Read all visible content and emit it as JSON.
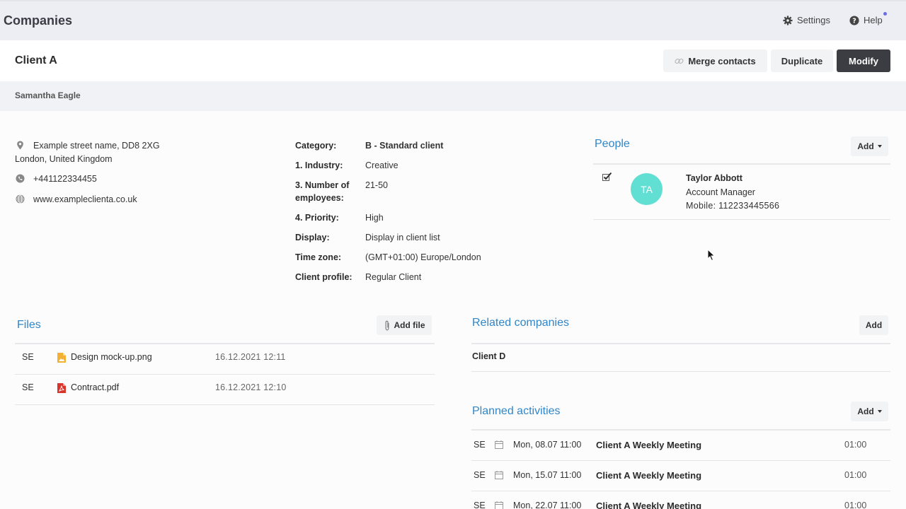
{
  "app": {
    "page_title": "Companies",
    "settings_label": "Settings",
    "help_label": "Help"
  },
  "client": {
    "name": "Client A",
    "owner": "Samantha Eagle",
    "buttons": {
      "merge": "Merge contacts",
      "duplicate": "Duplicate",
      "modify": "Modify"
    },
    "address_line1": "Example street name, DD8 2XG",
    "address_line2": "London, United Kingdom",
    "phone": "+441122334455",
    "website": "www.exampleclienta.co.uk"
  },
  "details": [
    {
      "label": "Category:",
      "value": "B - Standard client"
    },
    {
      "label": "1. Industry:",
      "value": "Creative"
    },
    {
      "label": "3. Number of employees:",
      "value": "21-50"
    },
    {
      "label": "4. Priority:",
      "value": "High"
    },
    {
      "label": "Display:",
      "value": "Display in client list"
    },
    {
      "label": "Time zone:",
      "value": "(GMT+01:00) Europe/London"
    },
    {
      "label": "Client profile:",
      "value": "Regular Client"
    }
  ],
  "people": {
    "title": "People",
    "add_label": "Add",
    "items": [
      {
        "initials": "TA",
        "name": "Taylor Abbott",
        "role": "Account Manager",
        "mobile": "Mobile: 112233445566",
        "avatar_color": "#62dfd3"
      }
    ]
  },
  "files": {
    "title": "Files",
    "add_label": "Add file",
    "items": [
      {
        "owner": "SE",
        "name": "Design mock-up.png",
        "date": "16.12.2021 12:11",
        "icon": "image-file-icon"
      },
      {
        "owner": "SE",
        "name": "Contract.pdf",
        "date": "16.12.2021 12:10",
        "icon": "pdf-file-icon"
      }
    ]
  },
  "related": {
    "title": "Related companies",
    "add_label": "Add",
    "items": [
      "Client D"
    ]
  },
  "activities": {
    "title": "Planned activities",
    "add_label": "Add",
    "items": [
      {
        "owner": "SE",
        "when": "Mon, 08.07 11:00",
        "name": "Client A Weekly Meeting",
        "duration": "01:00"
      },
      {
        "owner": "SE",
        "when": "Mon, 15.07 11:00",
        "name": "Client A Weekly Meeting",
        "duration": "01:00"
      },
      {
        "owner": "SE",
        "when": "Mon, 22.07 11:00",
        "name": "Client A Weekly Meeting",
        "duration": "01:00"
      }
    ]
  },
  "colors": {
    "accent": "#2f86c9",
    "primary_button": "#3b3d42",
    "avatar": "#62dfd3",
    "pdf": "#d9342b",
    "image_file": "#f2b134"
  }
}
